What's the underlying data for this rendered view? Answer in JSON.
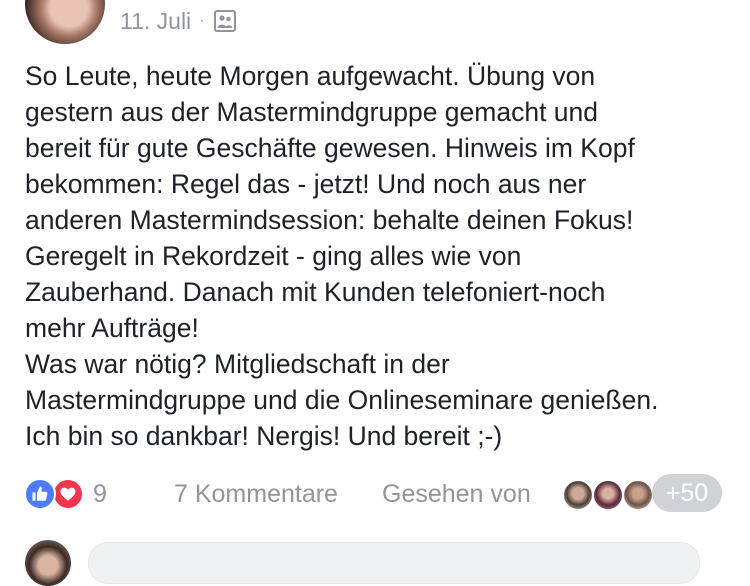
{
  "post": {
    "date": "11. Juli",
    "separator": "·",
    "audience_icon": "group-audience-icon",
    "text_lines": [
      "So Leute, heute Morgen aufgewacht. Übung von",
      "gestern aus der Mastermindgruppe gemacht und",
      "bereit für gute Geschäfte gewesen. Hinweis im Kopf",
      "bekommen: Regel das - jetzt! Und noch aus ner",
      "anderen Mastermindsession: behalte deinen Fokus!",
      "Geregelt in Rekordzeit - ging alles wie von",
      "Zauberhand. Danach mit Kunden telefoniert-noch",
      "mehr Aufträge!",
      "Was war nötig? Mitgliedschaft in der",
      "Mastermindgruppe und die Onlineseminare genießen.",
      "Ich bin so dankbar! Nergis! Und bereit ;-)"
    ]
  },
  "footer": {
    "reaction_icons": [
      "like-icon",
      "love-icon"
    ],
    "reaction_count": "9",
    "comments_label": "7 Kommentare",
    "seen_label": "Gesehen von",
    "seen_more": "+50"
  },
  "colors": {
    "like": "#4a7dff",
    "love": "#f0354d",
    "meta_text": "#90949c",
    "body_text": "#1d2129"
  }
}
